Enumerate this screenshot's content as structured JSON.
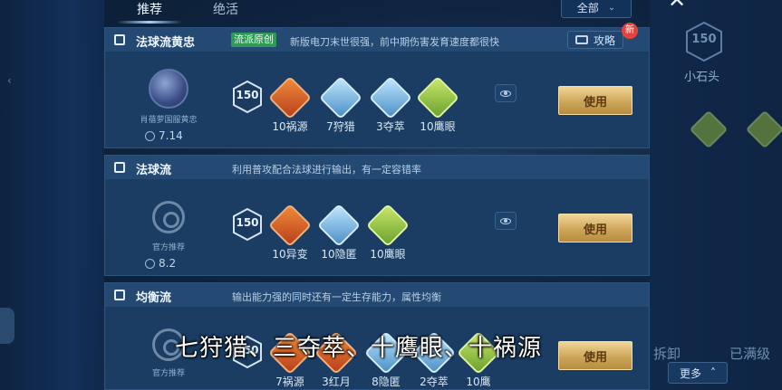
{
  "tabs": {
    "recommend": "推荐",
    "unique": "绝活"
  },
  "filter": {
    "label": "全部"
  },
  "guide_label": "攻略",
  "new_badge": "新",
  "hero_level": "150",
  "cards": [
    {
      "title": "法球流黄忠",
      "tag": "流派原创",
      "desc": "新版电刀末世很强，前中期伤害发育速度都很快",
      "author": "肖蓓萝国服黄忠",
      "score": "7.14",
      "gems": [
        {
          "label": "10祸源",
          "color": "red"
        },
        {
          "label": "7狩猎",
          "color": "blue"
        },
        {
          "label": "3夺萃",
          "color": "blue"
        },
        {
          "label": "10鹰眼",
          "color": "green"
        }
      ],
      "use_label": "使用"
    },
    {
      "title": "法球流",
      "desc": "利用普攻配合法球进行输出，有一定容错率",
      "author": "官方推荐",
      "score": "8.2",
      "gems": [
        {
          "label": "10异变",
          "color": "red"
        },
        {
          "label": "10隐匿",
          "color": "blue"
        },
        {
          "label": "10鹰眼",
          "color": "green"
        }
      ],
      "use_label": "使用"
    },
    {
      "title": "均衡流",
      "desc": "输出能力强的同时还有一定生存能力，属性均衡",
      "author": "官方推荐",
      "gems": [
        {
          "label": "7祸源",
          "color": "red"
        },
        {
          "label": "3红月",
          "color": "red"
        },
        {
          "label": "8隐匿",
          "color": "blue"
        },
        {
          "label": "2夺萃",
          "color": "blue"
        },
        {
          "label": "10鹰",
          "color": "green"
        }
      ],
      "use_label": "使用"
    }
  ],
  "right_panel": {
    "level": "150",
    "name": "小石头",
    "uninstall": "拆卸",
    "maxed": "已满级",
    "more": "更多"
  },
  "subtitle": "七狩猎、三夺萃、十鹰眼、十祸源"
}
